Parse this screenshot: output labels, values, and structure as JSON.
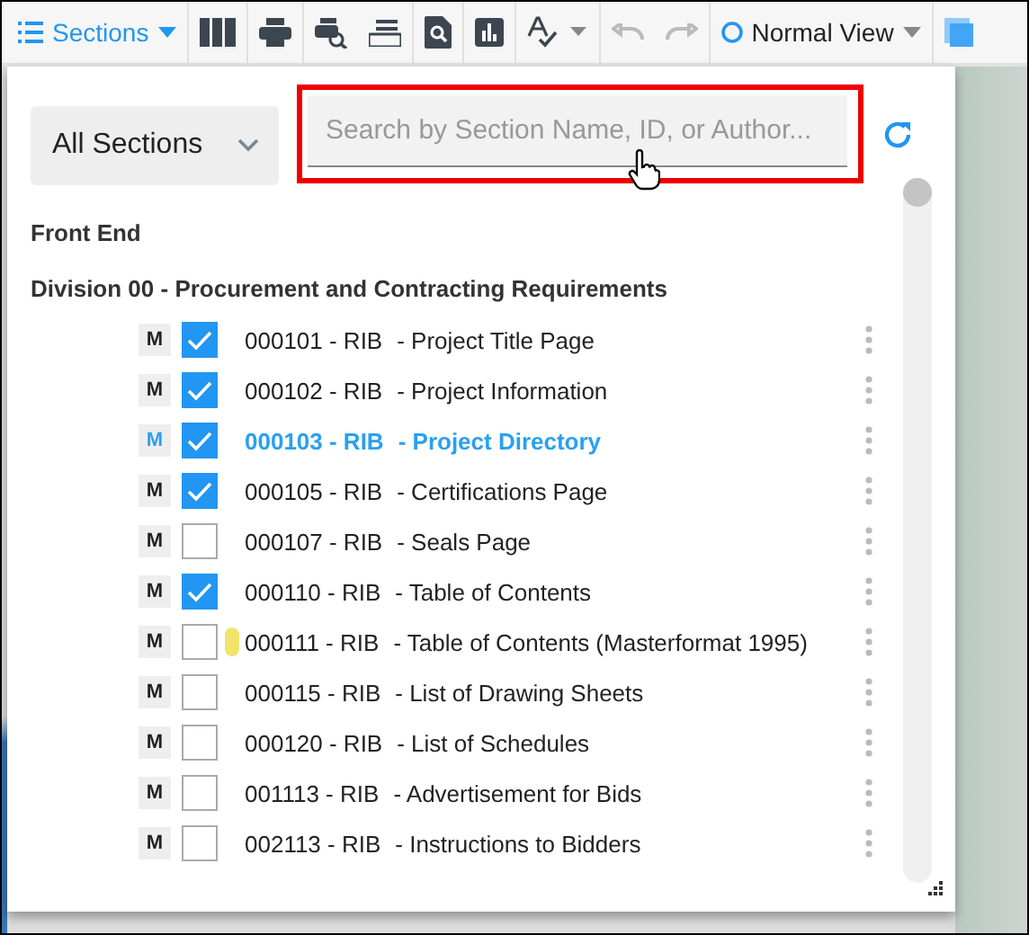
{
  "toolbar": {
    "sections_button": "Sections",
    "view_button": "Normal View"
  },
  "filter": {
    "dropdown": "All Sections",
    "search": {
      "placeholder": "Search by Section Name, ID, or Author..."
    }
  },
  "groups": [
    {
      "title": "Front End"
    },
    {
      "title": "Division 00 - Procurement and Contracting Requirements"
    }
  ],
  "sections": [
    {
      "badge": "M",
      "code": "000101 - RIB",
      "title": "- Project Title Page",
      "checked": true,
      "selected": false,
      "flagged": false
    },
    {
      "badge": "M",
      "code": "000102 - RIB",
      "title": "- Project Information",
      "checked": true,
      "selected": false,
      "flagged": false
    },
    {
      "badge": "M",
      "code": "000103 - RIB",
      "title": "- Project Directory",
      "checked": true,
      "selected": true,
      "flagged": false
    },
    {
      "badge": "M",
      "code": "000105 - RIB",
      "title": "- Certifications Page",
      "checked": true,
      "selected": false,
      "flagged": false
    },
    {
      "badge": "M",
      "code": "000107 - RIB",
      "title": "- Seals Page",
      "checked": false,
      "selected": false,
      "flagged": false
    },
    {
      "badge": "M",
      "code": "000110 - RIB",
      "title": "- Table of Contents",
      "checked": true,
      "selected": false,
      "flagged": false
    },
    {
      "badge": "M",
      "code": "000111 - RIB",
      "title": "- Table of Contents (Masterformat 1995)",
      "checked": false,
      "selected": false,
      "flagged": true
    },
    {
      "badge": "M",
      "code": "000115 - RIB",
      "title": "- List of Drawing Sheets",
      "checked": false,
      "selected": false,
      "flagged": false
    },
    {
      "badge": "M",
      "code": "000120 - RIB",
      "title": "- List of Schedules",
      "checked": false,
      "selected": false,
      "flagged": false
    },
    {
      "badge": "M",
      "code": "001113 - RIB",
      "title": "- Advertisement for Bids",
      "checked": false,
      "selected": false,
      "flagged": false
    },
    {
      "badge": "M",
      "code": "002113 - RIB",
      "title": "- Instructions to Bidders",
      "checked": false,
      "selected": false,
      "flagged": false
    }
  ]
}
